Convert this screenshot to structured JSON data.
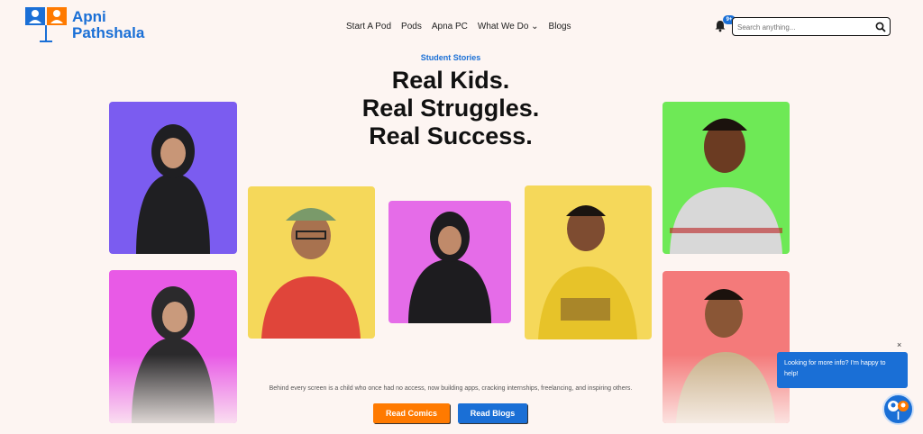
{
  "brand": {
    "line1": "Apni",
    "line2": "Pathshala"
  },
  "nav": {
    "items": [
      "Start A Pod",
      "Pods",
      "Apna PC",
      "What We Do",
      "Blogs"
    ],
    "dropdown_mark": "⌄"
  },
  "notifications": {
    "badge": "9+"
  },
  "search": {
    "placeholder": "Search anything..."
  },
  "hero": {
    "eyebrow": "Student Stories",
    "headline": [
      "Real Kids.",
      "Real Struggles.",
      "Real Success."
    ],
    "tagline": "Behind every screen is a child who once had no access, now building apps, cracking internships, freelancing, and inspiring others.",
    "primary_cta": "Read Comics",
    "secondary_cta": "Read Blogs"
  },
  "chat": {
    "message": "Looking for more info? I'm happy to help!",
    "close": "×"
  },
  "colors": {
    "accent_blue": "#1a6fd6",
    "accent_orange": "#ff7a00",
    "background": "#fdf5f2"
  },
  "photos": [
    {
      "name": "student-photo-1",
      "bg": "#7b5cf0"
    },
    {
      "name": "student-photo-2",
      "bg": "#e85ae6"
    },
    {
      "name": "student-photo-3",
      "bg": "#f5d85a"
    },
    {
      "name": "student-photo-4",
      "bg": "#e56ce8"
    },
    {
      "name": "student-photo-5",
      "bg": "#f5d85a"
    },
    {
      "name": "student-photo-6",
      "bg": "#6ee956"
    },
    {
      "name": "student-photo-7",
      "bg": "#f47a7a"
    }
  ]
}
